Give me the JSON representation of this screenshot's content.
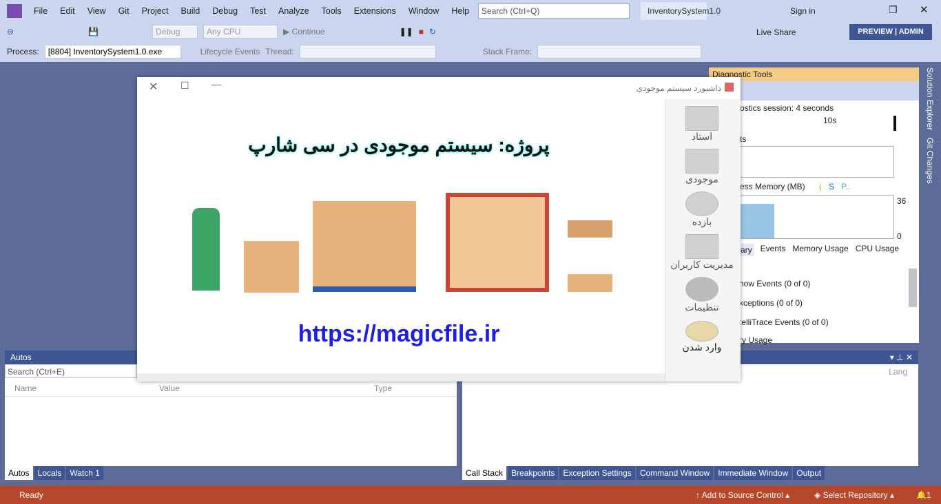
{
  "menu": [
    "File",
    "Edit",
    "View",
    "Git",
    "Project",
    "Build",
    "Debug",
    "Test",
    "Analyze",
    "Tools",
    "Extensions",
    "Window",
    "Help"
  ],
  "search_placeholder": "Search (Ctrl+Q)",
  "solution_title": "InventorySystem1.0",
  "sign_in": "Sign in",
  "live_share": "Live Share",
  "preview_admin": "PREVIEW | ADMIN",
  "toolbar": {
    "config": "Debug",
    "platform": "Any CPU",
    "continue": "Continue"
  },
  "debug_bar": {
    "process_label": "Process:",
    "process": "[8804] InventorySystem1.0.exe",
    "lifecycle": "Lifecycle Events",
    "thread_label": "Thread:",
    "stack_frame_label": "Stack Frame:"
  },
  "diagnostics": {
    "title": "Diagnostic Tools",
    "session": "ostics session: 4 seconds",
    "tick": "10s",
    "events_label": "ts",
    "memory_label": "ess Memory (MB)",
    "legend": [
      "(",
      "S",
      "P.."
    ],
    "mem_max": "36",
    "mem_min": "0",
    "tabs": [
      "ary",
      "Events",
      "Memory Usage",
      "CPU Usage"
    ],
    "rows": [
      "how Events (0 of 0)",
      "xceptions (0 of 0)",
      "telliTrace Events (0 of 0)",
      "ry Usage"
    ]
  },
  "side_tabs": [
    "Solution Explorer",
    "Git Changes"
  ],
  "autos": {
    "title": "Autos",
    "search": "Search (Ctrl+E)",
    "columns": [
      "Name",
      "Value",
      "Type"
    ],
    "tabs": [
      "Autos",
      "Locals",
      "Watch 1"
    ]
  },
  "callstack": {
    "column": "Lang",
    "tabs": [
      "Call Stack",
      "Breakpoints",
      "Exception Settings",
      "Command Window",
      "Immediate Window",
      "Output"
    ]
  },
  "status": {
    "ready": "Ready",
    "source_control": "Add to Source Control",
    "repo": "Select Repository",
    "notif": "1"
  },
  "app": {
    "title": "داشبورد سیستم موجودی",
    "heading": "پروژه: سیستم موجودی در سی شارپ",
    "url": "https://magicfile.ir",
    "side": [
      "استاد",
      "موجودی",
      "بازده",
      "مدیریت کاربران",
      "تنظیمات",
      "وارد شدن"
    ]
  }
}
